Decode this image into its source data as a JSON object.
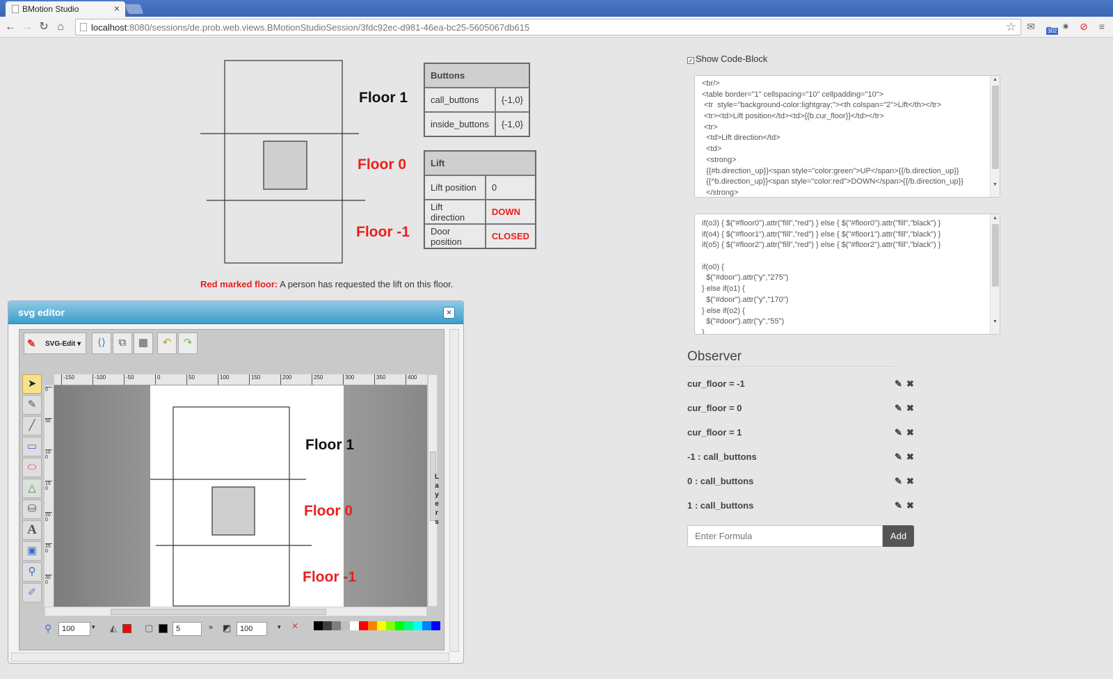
{
  "browser": {
    "tab_title": "BMotion Studio",
    "tab_close": "×",
    "url_host": "localhost",
    "url_rest": ":8080/sessions/de.prob.web.views.BMotionStudioSession/3fdc92ec-d981-46ea-bc25-5605067db615",
    "back_icon": "←",
    "forward_icon": "→",
    "reload_icon": "↻",
    "home_icon": "⌂",
    "star_icon": "☆",
    "badge": "302"
  },
  "visualization": {
    "floors": [
      {
        "label": "Floor 1",
        "color": "#111111"
      },
      {
        "label": "Floor 0",
        "color": "#e8201f"
      },
      {
        "label": "Floor -1",
        "color": "#e8201f"
      }
    ],
    "buttons_table": {
      "header": "Buttons",
      "rows": [
        {
          "name": "call_buttons",
          "value": "{-1,0}"
        },
        {
          "name": "inside_buttons",
          "value": "{-1,0}"
        }
      ]
    },
    "lift_table": {
      "header": "Lift",
      "rows": [
        {
          "name": "Lift position",
          "value": "0"
        },
        {
          "name": "Lift direction",
          "value": "DOWN"
        },
        {
          "name": "Door position",
          "value": "CLOSED"
        }
      ]
    },
    "legend_bold": "Red marked floor:",
    "legend_text": " A person has requested the lift on this floor."
  },
  "code_block": {
    "checkbox_label": "Show Code-Block",
    "checked": true,
    "html_lines": [
      "<br/>",
      "<table border=\"1\" cellspacing=\"10\" cellpadding=\"10\">",
      " <tr  style=\"background-color:lightgray;\"><th colspan=\"2\">Lift</th></tr>",
      " <tr><td>Lift position</td><td>{{b.cur_floor}}</td></tr>",
      " <tr>",
      "  <td>Lift direction</td>",
      "  <td>",
      "  <strong>",
      "  {{#b.direction_up}}<span style=\"color:green\">UP</span>{{/b.direction_up}}",
      "  {{^b.direction_up}}<span style=\"color:red\">DOWN</span>{{/b.direction_up}}",
      "  </strong>"
    ],
    "js_lines": [
      "if(o3) { $(\"#floor0\").attr(\"fill\",\"red\") } else { $(\"#floor0\").attr(\"fill\",\"black\") }",
      "if(o4) { $(\"#floor1\").attr(\"fill\",\"red\") } else { $(\"#floor1\").attr(\"fill\",\"black\") }",
      "if(o5) { $(\"#floor2\").attr(\"fill\",\"red\") } else { $(\"#floor2\").attr(\"fill\",\"black\") }",
      "",
      "if(o0) {",
      "  $(\"#door\").attr(\"y\",\"275\")",
      "} else if(o1) {",
      "  $(\"#door\").attr(\"y\",\"170\")",
      "} else if(o2) {",
      "  $(\"#door\").attr(\"y\",\"55\")",
      "}"
    ]
  },
  "observer": {
    "title": "Observer",
    "items": [
      "cur_floor = -1",
      "cur_floor = 0",
      "cur_floor = 1",
      "-1 : call_buttons",
      "0 : call_buttons",
      "1 : call_buttons"
    ],
    "edit_icon": "✎",
    "delete_icon": "✖",
    "formula_placeholder": "Enter Formula",
    "add_label": "Add"
  },
  "svg_editor": {
    "title": "svg editor",
    "close_icon": "×",
    "menu_label": "SVG-Edit ▾",
    "ruler_ticks": [
      "-150",
      "-100",
      "-50",
      "0",
      "50",
      "100",
      "150",
      "200",
      "250",
      "300",
      "350",
      "400"
    ],
    "ruler_v_ticks": [
      "0",
      "50",
      "100",
      "150",
      "200",
      "250",
      "300"
    ],
    "zoom": "100",
    "stroke_width": "5",
    "opacity": "100",
    "layers_label": "Layers",
    "fill_color": "#ff0000",
    "stroke_color": "#000000",
    "palette": [
      "#000000",
      "#3f3f3f",
      "#7f7f7f",
      "#bfbfbf",
      "#ffffff",
      "#ff0000",
      "#ff7f00",
      "#ffff00",
      "#7fff00",
      "#00ff00",
      "#00ff7f",
      "#00ffff",
      "#007fff",
      "#0000ff"
    ]
  }
}
